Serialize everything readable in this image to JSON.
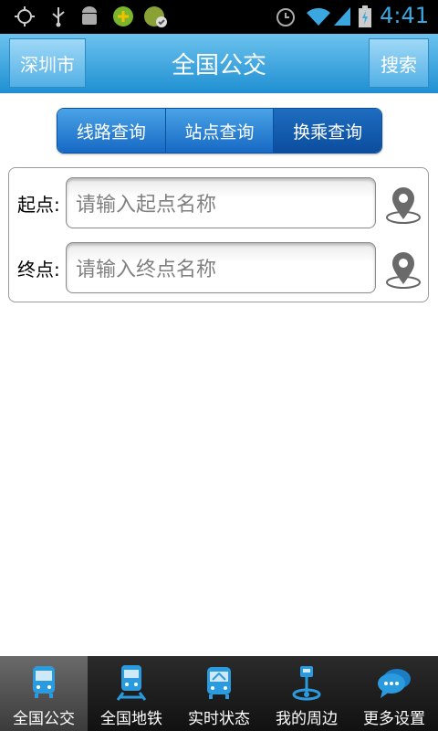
{
  "status_bar": {
    "time": "4:41"
  },
  "header": {
    "city_button": "深圳市",
    "title": "全国公交",
    "search_button": "搜索"
  },
  "tabs": [
    {
      "label": "线路查询",
      "active": false
    },
    {
      "label": "站点查询",
      "active": false
    },
    {
      "label": "换乘查询",
      "active": true
    }
  ],
  "form": {
    "start_label": "起点:",
    "start_placeholder": "请输入起点名称",
    "end_label": "终点:",
    "end_placeholder": "请输入终点名称"
  },
  "bottom_nav": [
    {
      "label": "全国公交",
      "icon": "bus-icon",
      "active": true
    },
    {
      "label": "全国地铁",
      "icon": "metro-icon",
      "active": false
    },
    {
      "label": "实时状态",
      "icon": "realtime-bus-icon",
      "active": false
    },
    {
      "label": "我的周边",
      "icon": "nearby-icon",
      "active": false
    },
    {
      "label": "更多设置",
      "icon": "chat-bubble-icon",
      "active": false
    }
  ],
  "colors": {
    "accent": "#1f8fd2",
    "tab_active": "#0b4d9e",
    "nav_icon": "#2b9be0"
  }
}
